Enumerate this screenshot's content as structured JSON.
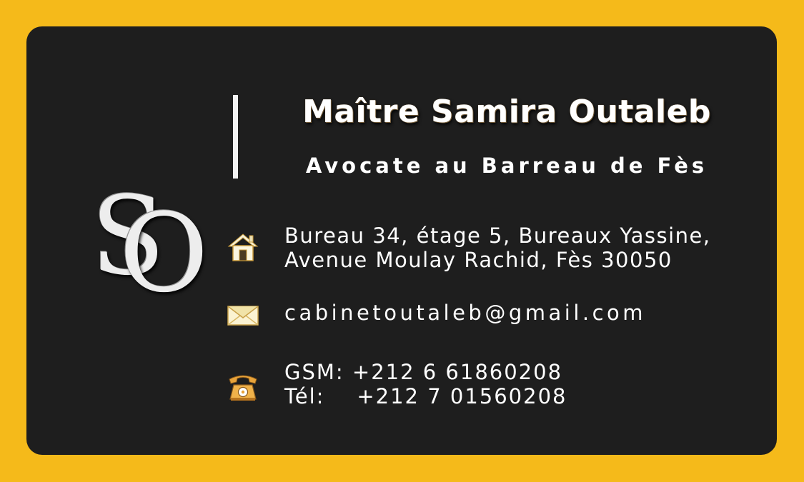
{
  "card": {
    "monogram": {
      "first": "S",
      "second": "O"
    },
    "name": "Maître Samira Outaleb",
    "title": "Avocate au Barreau de Fès",
    "address": {
      "icon": "house-icon",
      "line1": "Bureau 34, étage 5, Bureaux Yassine,",
      "line2": "Avenue Moulay Rachid, Fès 30050"
    },
    "email": {
      "icon": "envelope-icon",
      "value": "cabinetoutaleb@gmail.com"
    },
    "phone": {
      "icon": "telephone-icon",
      "gsm": "GSM: +212 6 61860208",
      "tel": "Tél:    +212 7 01560208"
    }
  },
  "colors": {
    "background": "#F5BA1A",
    "card": "#1E1E1E",
    "text": "#FFFFFF"
  }
}
